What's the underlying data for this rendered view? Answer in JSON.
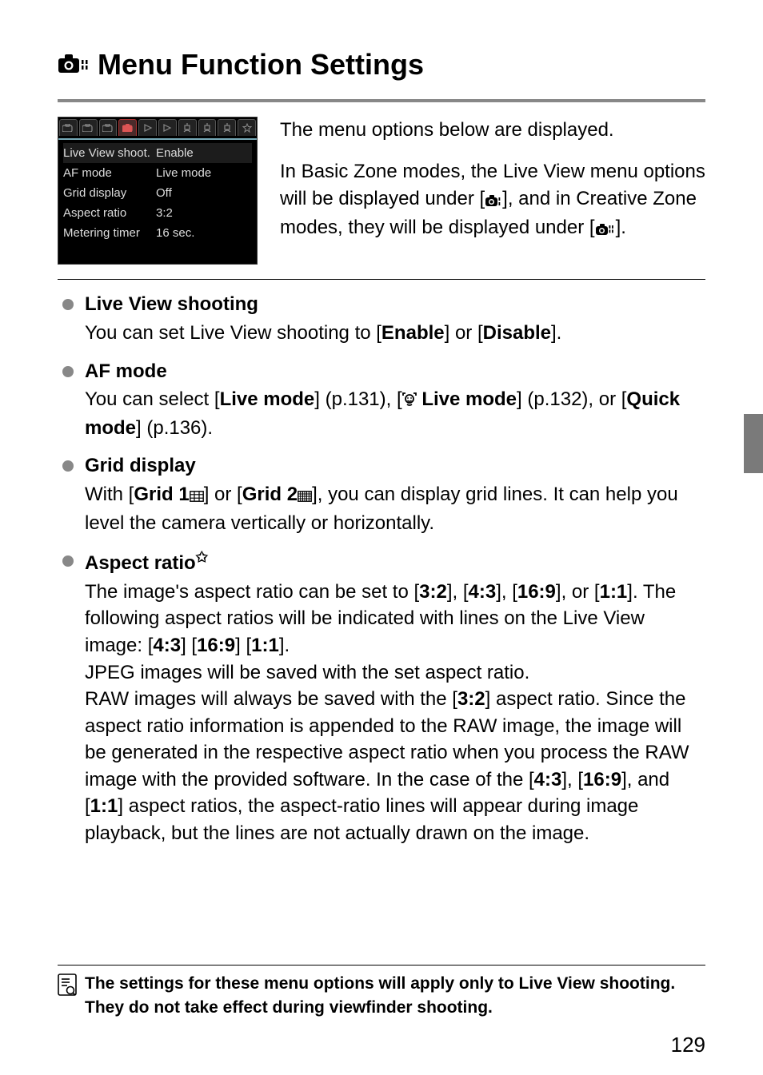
{
  "title": "Menu Function Settings",
  "menu_screenshot": {
    "rows": [
      {
        "label": "Live View shoot.",
        "value": "Enable",
        "selected": true
      },
      {
        "label": "AF mode",
        "value": "Live mode",
        "selected": false
      },
      {
        "label": "Grid display",
        "value": "Off",
        "selected": false
      },
      {
        "label": "Aspect ratio",
        "value": "3:2",
        "selected": false
      },
      {
        "label": "Metering timer",
        "value": "16 sec.",
        "selected": false
      }
    ]
  },
  "intro": {
    "p1": "The menu options below are displayed.",
    "p2a": "In Basic Zone modes, the Live View menu options will be displayed under [",
    "p2b": "], and in Creative Zone modes, they will be displayed under [",
    "p2c": "]."
  },
  "items": {
    "lvshoot": {
      "title": "Live View shooting",
      "body_a": "You can set Live View shooting to [",
      "enable": "Enable",
      "body_b": "] or [",
      "disable": "Disable",
      "body_c": "]."
    },
    "afmode": {
      "title": "AF mode",
      "a": "You can select [",
      "live": "Live mode",
      "b": "] (p.131), [",
      "face_live": " Live mode",
      "c": "] (p.132), or [",
      "quick": "Quick mode",
      "d": "] (p.136)."
    },
    "grid": {
      "title": "Grid display",
      "a": "With [",
      "g1": "Grid 1",
      "b": "] or [",
      "g2": "Grid 2",
      "c": "], you can display grid lines. It can help you level the camera vertically or horizontally."
    },
    "aspect": {
      "title": "Aspect ratio",
      "p1a": "The image's aspect ratio can be set to [",
      "r32": "3:2",
      "p1b": "], [",
      "r43": "4:3",
      "p1c": "], [",
      "r169": "16:9",
      "p1d": "], or [",
      "r11": "1:1",
      "p1e": "]. The following aspect ratios will be indicated with lines on the Live View image: [",
      "p1f": "] [",
      "p1g": "] [",
      "p1h": "].",
      "p2": "JPEG images will be saved with the set aspect ratio.",
      "p3a": "RAW images will always be saved with the [",
      "p3b": "] aspect ratio. Since the aspect ratio information is appended to the RAW image, the image will be generated in the respective aspect ratio when you process the RAW image with the provided software. In the case of the [",
      "p3c": "], [",
      "p3d": "], and [",
      "p3e": "] aspect ratios, the aspect-ratio lines will appear during image playback, but the lines are not actually drawn on the image."
    }
  },
  "note": "The settings for these menu options will apply only to Live View shooting. They do not take effect during viewfinder shooting.",
  "page_number": "129"
}
